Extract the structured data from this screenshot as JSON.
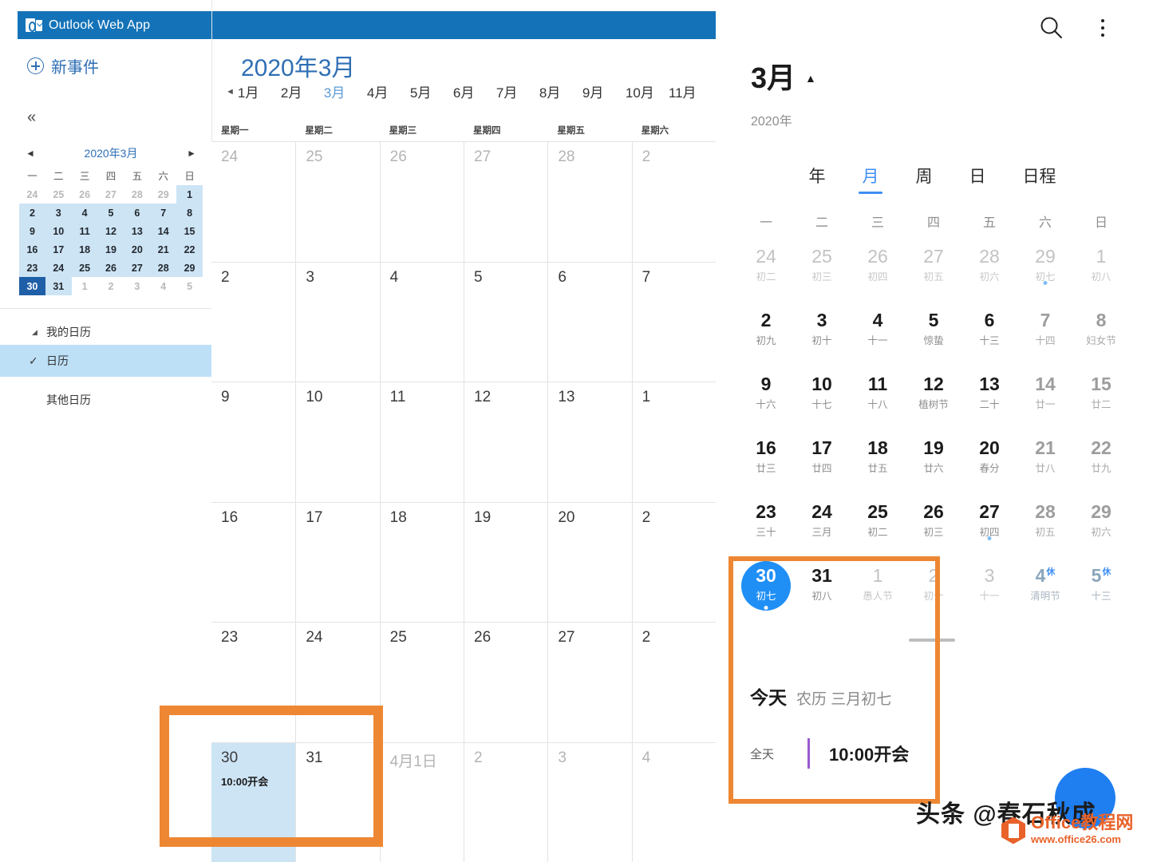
{
  "owa": {
    "app_title": "Outlook Web App",
    "new_event_label": "新事件",
    "collapse_label": "«",
    "mini_calendar": {
      "title": "2020年3月",
      "prev": "◄",
      "next": "►",
      "dow": [
        "一",
        "二",
        "三",
        "四",
        "五",
        "六",
        "日"
      ],
      "weeks": [
        [
          {
            "d": "24",
            "t": "out"
          },
          {
            "d": "25",
            "t": "out"
          },
          {
            "d": "26",
            "t": "out"
          },
          {
            "d": "27",
            "t": "out"
          },
          {
            "d": "28",
            "t": "out"
          },
          {
            "d": "29",
            "t": "out"
          },
          {
            "d": "1",
            "t": "in"
          }
        ],
        [
          {
            "d": "2",
            "t": "in"
          },
          {
            "d": "3",
            "t": "in"
          },
          {
            "d": "4",
            "t": "in"
          },
          {
            "d": "5",
            "t": "in"
          },
          {
            "d": "6",
            "t": "in"
          },
          {
            "d": "7",
            "t": "in"
          },
          {
            "d": "8",
            "t": "in"
          }
        ],
        [
          {
            "d": "9",
            "t": "in"
          },
          {
            "d": "10",
            "t": "in"
          },
          {
            "d": "11",
            "t": "in"
          },
          {
            "d": "12",
            "t": "in"
          },
          {
            "d": "13",
            "t": "in"
          },
          {
            "d": "14",
            "t": "in"
          },
          {
            "d": "15",
            "t": "in"
          }
        ],
        [
          {
            "d": "16",
            "t": "in"
          },
          {
            "d": "17",
            "t": "in"
          },
          {
            "d": "18",
            "t": "in"
          },
          {
            "d": "19",
            "t": "in"
          },
          {
            "d": "20",
            "t": "in"
          },
          {
            "d": "21",
            "t": "in"
          },
          {
            "d": "22",
            "t": "in"
          }
        ],
        [
          {
            "d": "23",
            "t": "in"
          },
          {
            "d": "24",
            "t": "in"
          },
          {
            "d": "25",
            "t": "in"
          },
          {
            "d": "26",
            "t": "in"
          },
          {
            "d": "27",
            "t": "in"
          },
          {
            "d": "28",
            "t": "in"
          },
          {
            "d": "29",
            "t": "in"
          }
        ],
        [
          {
            "d": "30",
            "t": "today"
          },
          {
            "d": "31",
            "t": "in"
          },
          {
            "d": "1",
            "t": "out"
          },
          {
            "d": "2",
            "t": "out"
          },
          {
            "d": "3",
            "t": "out"
          },
          {
            "d": "4",
            "t": "out"
          },
          {
            "d": "5",
            "t": "out"
          }
        ]
      ]
    },
    "sidebar_items": [
      {
        "label": "我的日历",
        "type": "group"
      },
      {
        "label": "日历",
        "type": "selected"
      },
      {
        "label": "其他日历",
        "type": "plain"
      }
    ],
    "month_title": "2020年3月",
    "month_tabs": [
      "1月",
      "2月",
      "3月",
      "4月",
      "5月",
      "6月",
      "7月",
      "8月",
      "9月",
      "10月",
      "11月"
    ],
    "active_month_tab": "3月",
    "dow_headers": [
      "星期一",
      "星期二",
      "星期三",
      "星期四",
      "星期五",
      "星期六"
    ],
    "weeks": [
      [
        {
          "d": "24",
          "o": true
        },
        {
          "d": "25",
          "o": true
        },
        {
          "d": "26",
          "o": true
        },
        {
          "d": "27",
          "o": true
        },
        {
          "d": "28",
          "o": true
        },
        {
          "d": "2",
          "o": true
        }
      ],
      [
        {
          "d": "2"
        },
        {
          "d": "3"
        },
        {
          "d": "4"
        },
        {
          "d": "5"
        },
        {
          "d": "6"
        },
        {
          "d": "7"
        }
      ],
      [
        {
          "d": "9"
        },
        {
          "d": "10"
        },
        {
          "d": "11"
        },
        {
          "d": "12"
        },
        {
          "d": "13"
        },
        {
          "d": "1"
        }
      ],
      [
        {
          "d": "16"
        },
        {
          "d": "17"
        },
        {
          "d": "18"
        },
        {
          "d": "19"
        },
        {
          "d": "20"
        },
        {
          "d": "2"
        }
      ],
      [
        {
          "d": "23"
        },
        {
          "d": "24"
        },
        {
          "d": "25"
        },
        {
          "d": "26"
        },
        {
          "d": "27"
        },
        {
          "d": "2"
        }
      ],
      [
        {
          "d": "30",
          "sel": true,
          "event": "10:00开会"
        },
        {
          "d": "31"
        },
        {
          "d": "4月1日",
          "o": true
        },
        {
          "d": "2",
          "o": true
        },
        {
          "d": "3",
          "o": true
        },
        {
          "d": "4",
          "o": true
        }
      ]
    ]
  },
  "phone": {
    "search_icon": "search-icon",
    "more_icon": "more-vertical-icon",
    "month": "3月",
    "caret": "▲",
    "year": "2020年",
    "tabs": [
      "年",
      "月",
      "周",
      "日",
      "日程"
    ],
    "active_tab": "月",
    "dow": [
      "一",
      "二",
      "三",
      "四",
      "五",
      "六",
      "日"
    ],
    "days": [
      {
        "n": "24",
        "l": "初二",
        "s": "dim"
      },
      {
        "n": "25",
        "l": "初三",
        "s": "dim"
      },
      {
        "n": "26",
        "l": "初四",
        "s": "dim"
      },
      {
        "n": "27",
        "l": "初五",
        "s": "dim"
      },
      {
        "n": "28",
        "l": "初六",
        "s": "dim"
      },
      {
        "n": "29",
        "l": "初七",
        "s": "dim",
        "dot": true
      },
      {
        "n": "1",
        "l": "初八",
        "s": "dim"
      },
      {
        "n": "2",
        "l": "初九"
      },
      {
        "n": "3",
        "l": "初十"
      },
      {
        "n": "4",
        "l": "十一"
      },
      {
        "n": "5",
        "l": "惊蛰"
      },
      {
        "n": "6",
        "l": "十三"
      },
      {
        "n": "7",
        "l": "十四",
        "s": "weekend"
      },
      {
        "n": "8",
        "l": "妇女节",
        "s": "weekend"
      },
      {
        "n": "9",
        "l": "十六"
      },
      {
        "n": "10",
        "l": "十七"
      },
      {
        "n": "11",
        "l": "十八"
      },
      {
        "n": "12",
        "l": "植树节"
      },
      {
        "n": "13",
        "l": "二十"
      },
      {
        "n": "14",
        "l": "廿一",
        "s": "weekend"
      },
      {
        "n": "15",
        "l": "廿二",
        "s": "weekend"
      },
      {
        "n": "16",
        "l": "廿三"
      },
      {
        "n": "17",
        "l": "廿四"
      },
      {
        "n": "18",
        "l": "廿五"
      },
      {
        "n": "19",
        "l": "廿六"
      },
      {
        "n": "20",
        "l": "春分"
      },
      {
        "n": "21",
        "l": "廿八",
        "s": "weekend"
      },
      {
        "n": "22",
        "l": "廿九",
        "s": "weekend"
      },
      {
        "n": "23",
        "l": "三十"
      },
      {
        "n": "24",
        "l": "三月"
      },
      {
        "n": "25",
        "l": "初二"
      },
      {
        "n": "26",
        "l": "初三"
      },
      {
        "n": "27",
        "l": "初四",
        "dot": true
      },
      {
        "n": "28",
        "l": "初五",
        "s": "weekend"
      },
      {
        "n": "29",
        "l": "初六",
        "s": "weekend"
      },
      {
        "n": "30",
        "l": "初七",
        "s": "today",
        "dot": true
      },
      {
        "n": "31",
        "l": "初八"
      },
      {
        "n": "1",
        "l": "愚人节",
        "s": "dim"
      },
      {
        "n": "2",
        "l": "初十",
        "s": "dim"
      },
      {
        "n": "3",
        "l": "十一",
        "s": "dim"
      },
      {
        "n": "4",
        "l": "清明节",
        "s": "holiday",
        "badge": "休"
      },
      {
        "n": "5",
        "l": "十三",
        "s": "holiday",
        "badge": "休"
      }
    ],
    "today_label": "今天",
    "today_lunar": "农历 三月初七",
    "allday_label": "全天",
    "event_title": "10:00开会"
  },
  "watermarks": {
    "toutiao": "头条 @春石秋成",
    "office_name": "Office教程网",
    "office_url": "www.office26.com"
  },
  "colors": {
    "owa_header": "#1473b8",
    "accent_blue": "#2f6fb5",
    "selected_cell": "#cde4f5",
    "annotation_orange": "#ee8733",
    "phone_accent": "#3e8ef5",
    "today_circle": "#1f8ff5",
    "event_bar_purple": "#9b59d0"
  }
}
